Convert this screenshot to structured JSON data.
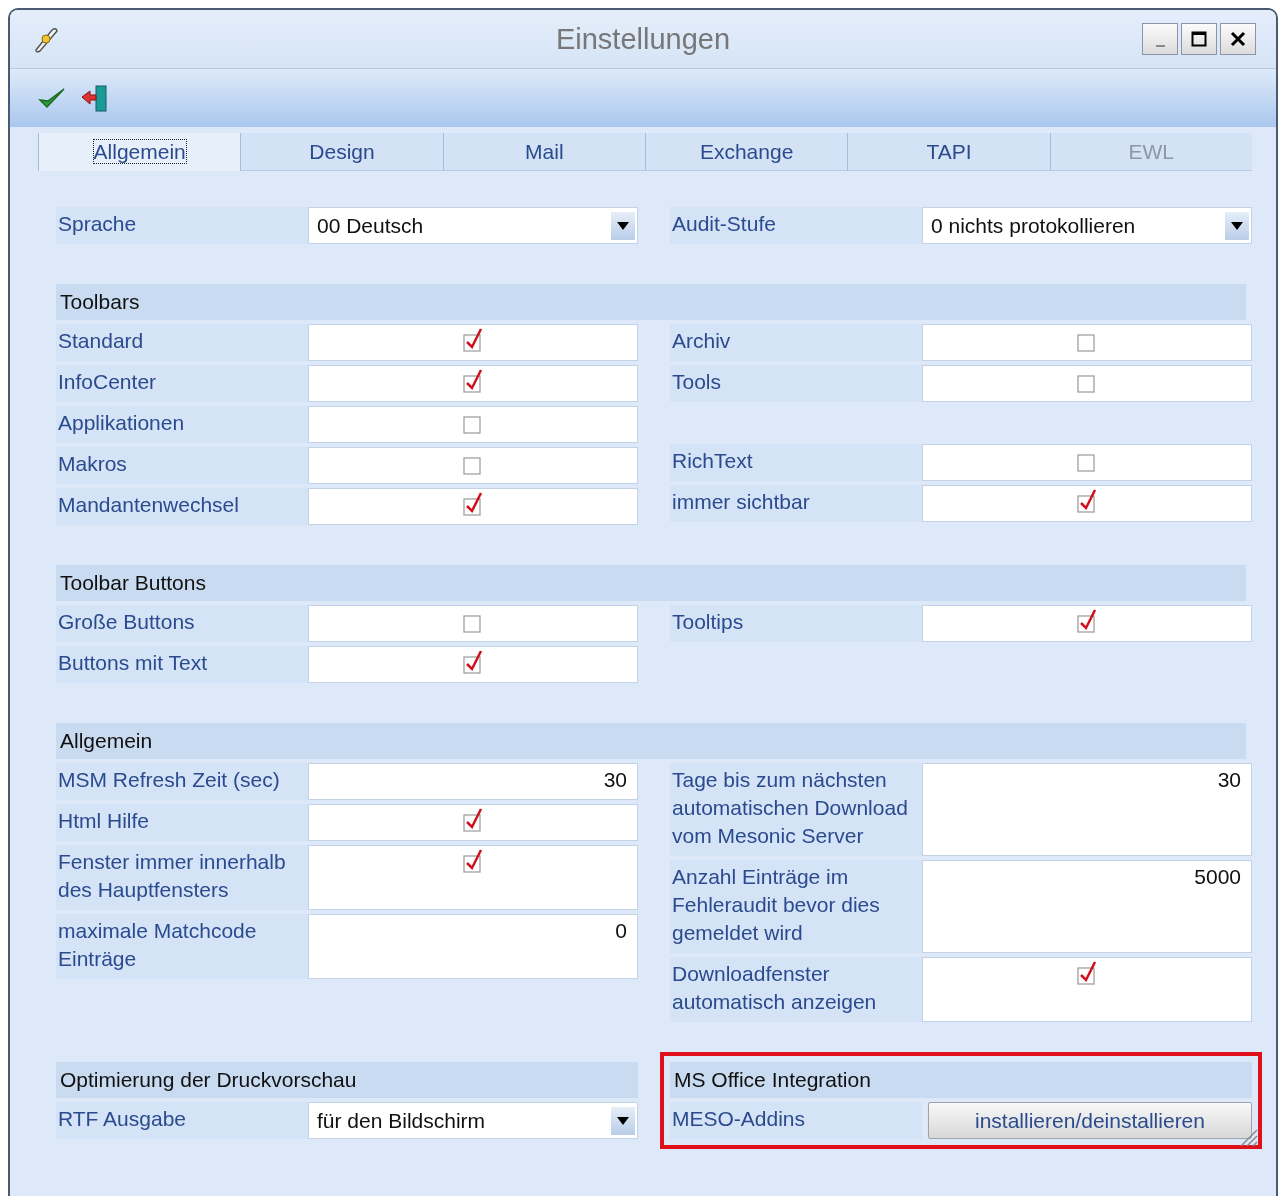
{
  "window": {
    "title": "Einstellungen"
  },
  "tabs": [
    {
      "label": "Allgemein",
      "selected": true,
      "disabled": false
    },
    {
      "label": "Design",
      "selected": false,
      "disabled": false
    },
    {
      "label": "Mail",
      "selected": false,
      "disabled": false
    },
    {
      "label": "Exchange",
      "selected": false,
      "disabled": false
    },
    {
      "label": "TAPI",
      "selected": false,
      "disabled": false
    },
    {
      "label": "EWL",
      "selected": false,
      "disabled": true
    }
  ],
  "sections": [
    {
      "columns": [
        {
          "fields": [
            {
              "kind": "dropdown",
              "label": "Sprache",
              "value": "00 Deutsch"
            }
          ]
        },
        {
          "fields": [
            {
              "kind": "dropdown",
              "label": "Audit-Stufe",
              "value": "0 nichts protokollieren"
            }
          ]
        }
      ]
    },
    {
      "title": "Toolbars",
      "columns": [
        {
          "fields": [
            {
              "kind": "checkbox",
              "label": "Standard",
              "checked": true
            },
            {
              "kind": "checkbox",
              "label": "InfoCenter",
              "checked": true
            },
            {
              "kind": "checkbox",
              "label": "Applikationen",
              "checked": false
            },
            {
              "kind": "checkbox",
              "label": "Makros",
              "checked": false
            },
            {
              "kind": "checkbox",
              "label": "Mandantenwechsel",
              "checked": true
            }
          ]
        },
        {
          "fields": [
            {
              "kind": "checkbox",
              "label": "Archiv",
              "checked": false
            },
            {
              "kind": "checkbox",
              "label": "Tools",
              "checked": false
            },
            {
              "kind": "blank"
            },
            {
              "kind": "checkbox",
              "label": "RichText",
              "checked": false
            },
            {
              "kind": "checkbox",
              "label": "immer sichtbar",
              "checked": true
            }
          ]
        }
      ]
    },
    {
      "title": "Toolbar Buttons",
      "columns": [
        {
          "fields": [
            {
              "kind": "checkbox",
              "label": "Große Buttons",
              "checked": false
            },
            {
              "kind": "checkbox",
              "label": "Buttons mit Text",
              "checked": true
            }
          ]
        },
        {
          "fields": [
            {
              "kind": "checkbox",
              "label": "Tooltips",
              "checked": true
            }
          ]
        }
      ]
    },
    {
      "title": "Allgemein",
      "columns": [
        {
          "fields": [
            {
              "kind": "number",
              "label": "MSM Refresh Zeit (sec)",
              "value": "30"
            },
            {
              "kind": "checkbox",
              "label": "Html Hilfe",
              "checked": true
            },
            {
              "kind": "checkbox",
              "label": "Fenster immer innerhalb des Hauptfensters",
              "checked": true
            },
            {
              "kind": "number",
              "label": "maximale Matchcode Einträge",
              "value": "0"
            }
          ]
        },
        {
          "fields": [
            {
              "kind": "number",
              "label": "Tage bis zum nächsten automatischen Download vom Mesonic Server",
              "value": "30"
            },
            {
              "kind": "number",
              "label": "Anzahl Einträge im Fehleraudit bevor dies gemeldet wird",
              "value": "5000"
            },
            {
              "kind": "checkbox",
              "label": "Downloadfenster automatisch anzeigen",
              "checked": true
            }
          ]
        }
      ]
    },
    {
      "columns": [
        {
          "title": "Optimierung der Druckvorschau",
          "highlighted": false,
          "fields": [
            {
              "kind": "dropdown",
              "label": "RTF Ausgabe",
              "value": "für den Bildschirm"
            }
          ]
        },
        {
          "title": "MS Office Integration",
          "highlighted": true,
          "fields": [
            {
              "kind": "button",
              "label": "MESO-Addins",
              "value": "installieren/deinstallieren"
            }
          ]
        }
      ]
    }
  ]
}
